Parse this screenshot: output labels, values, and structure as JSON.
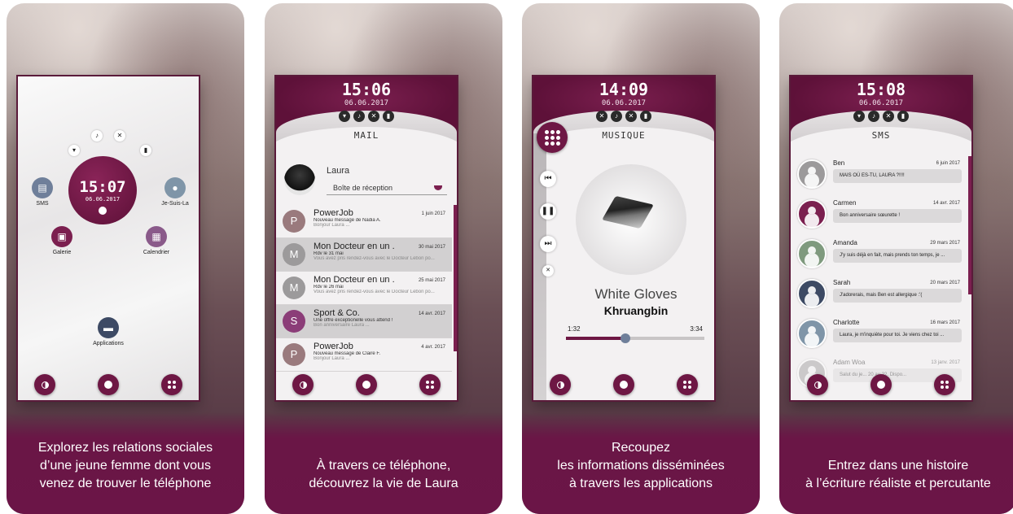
{
  "panels": [
    {
      "caption": [
        "Explorez les relations sociales",
        "d’une jeune femme dont vous",
        "venez de trouver le téléphone"
      ],
      "clock": {
        "time": "15:07",
        "date": "06.06.2017"
      },
      "apps": {
        "sms": "SMS",
        "jesuisla": "Je-Suis-La",
        "galerie": "Galerie",
        "calendrier": "Calendrier",
        "applications": "Applications"
      }
    },
    {
      "caption": [
        "À travers ce téléphone,",
        "découvrez la vie de Laura"
      ],
      "time": "15:06",
      "date": "06.06.2017",
      "title": "MAIL",
      "contact": {
        "name": "Laura",
        "folder": "Boîte de réception"
      },
      "mails": [
        {
          "initial": "P",
          "subject": "PowerJob",
          "date": "1 juin 2017",
          "line1": "Nouveau message de Nadia A.",
          "line2": "Bonjour Laura ..."
        },
        {
          "initial": "M",
          "subject": "Mon Docteur en un ...",
          "date": "30 mai 2017",
          "line1": "Rdv le 31 mai",
          "line2": "Vous avez pris rendez-vous avec le Docteur Lebon po..."
        },
        {
          "initial": "M",
          "subject": "Mon Docteur en un ...",
          "date": "25 mai 2017",
          "line1": "Rdv le 26 mai",
          "line2": "Vous avez pris rendez-vous avec le Docteur Lebon po..."
        },
        {
          "initial": "S",
          "subject": "Sport & Co.",
          "date": "14 avr. 2017",
          "line1": "Une offre exceptionelle vous attend !",
          "line2": "Bon anniversaire Laura ..."
        },
        {
          "initial": "P",
          "subject": "PowerJob",
          "date": "4 avr. 2017",
          "line1": "Nouveau message de Claire F.",
          "line2": "Bonjour Laura ..."
        }
      ]
    },
    {
      "caption": [
        "Recoupez",
        "les informations disséminées",
        "à travers les applications"
      ],
      "time": "14:09",
      "date": "06.06.2017",
      "title": "MUSIQUE",
      "song": "White Gloves",
      "artist": "Khruangbin",
      "elapsed": "1:32",
      "duration": "3:34",
      "progress": 0.43
    },
    {
      "caption": [
        "Entrez dans une histoire",
        "à l’écriture réaliste et percutante"
      ],
      "time": "15:08",
      "date": "06.06.2017",
      "title": "SMS",
      "messages": [
        {
          "name": "Ben",
          "date": "6 juin 2017",
          "text": "MAIS OÙ ES-TU, LAURA ?!!!!"
        },
        {
          "name": "Carmen",
          "date": "14 avr. 2017",
          "text": "Bon anniversaire sœurette !"
        },
        {
          "name": "Amanda",
          "date": "29 mars 2017",
          "text": "J'y suis déjà en fait, mais prends ton temps, je ..."
        },
        {
          "name": "Sarah",
          "date": "20 mars 2017",
          "text": "J'adorerais, mais Ben est allergique :'("
        },
        {
          "name": "Charlotte",
          "date": "16 mars 2017",
          "text": "Laura, je m'inquiète pour toi. Je viens chez toi ..."
        },
        {
          "name": "Adam Woa",
          "date": "13 janv. 2017",
          "text": "Salut du je... 20 au 22. Dispo..."
        }
      ]
    }
  ],
  "colors": {
    "brand": "#6e1744",
    "accent": "#7b1f4f"
  }
}
